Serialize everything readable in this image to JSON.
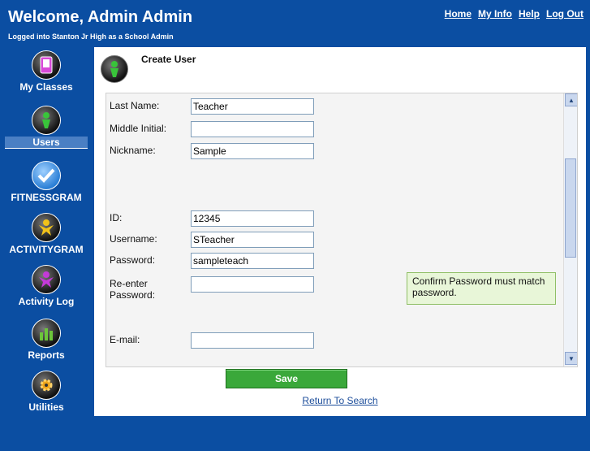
{
  "header": {
    "title": "Welcome, Admin Admin",
    "subtitle": "Logged into Stanton Jr High as a School Admin",
    "links": [
      "Home",
      "My Info",
      "Help",
      "Log Out"
    ]
  },
  "sidebar": {
    "items": [
      {
        "label": "My Classes",
        "icon": "device-icon"
      },
      {
        "label": "Users",
        "icon": "person-icon"
      },
      {
        "label": "FITNESSGRAM",
        "icon": "checkmark-icon"
      },
      {
        "label": "ACTIVITYGRAM",
        "icon": "person-icon"
      },
      {
        "label": "Activity Log",
        "icon": "person-icon"
      },
      {
        "label": "Reports",
        "icon": "bar-chart-icon"
      },
      {
        "label": "Utilities",
        "icon": "gear-icon"
      }
    ],
    "active": "Users"
  },
  "panel": {
    "title": "Create User",
    "fields": {
      "last_name_label": "Last Name:",
      "last_name_value": "Teacher",
      "middle_initial_label": "Middle Initial:",
      "middle_initial_value": "",
      "nickname_label": "Nickname:",
      "nickname_value": "Sample",
      "id_label": "ID:",
      "id_value": "12345",
      "username_label": "Username:",
      "username_value": "STeacher",
      "password_label": "Password:",
      "password_value": "sampleteach",
      "reenter_label": "Re-enter Password:",
      "reenter_value": "",
      "email_label": "E-mail:",
      "email_value": ""
    },
    "hint": "Confirm Password must match password.",
    "save_label": "Save",
    "return_label": "Return To Search"
  }
}
